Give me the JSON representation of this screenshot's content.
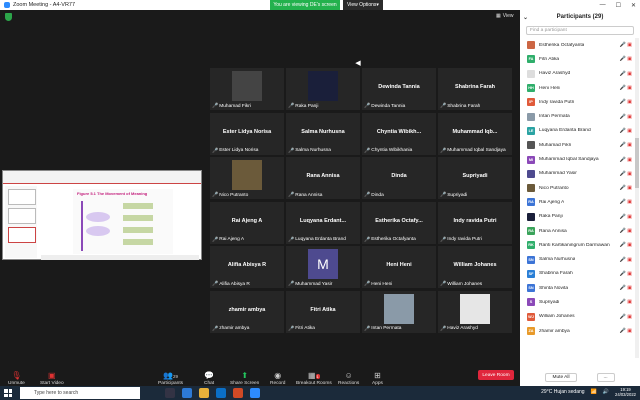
{
  "titlebar": {
    "title": "Zoom Meeting - A4-VR77",
    "viewing": "You are viewing DE's screen",
    "view_options": "View Options"
  },
  "meeting": {
    "view_label": "View",
    "pager": "◀"
  },
  "share": {
    "slide_title": "Figure 5.1 The Movement of Meaning"
  },
  "tiles": [
    {
      "name": "",
      "label": "Muhamad Fikri",
      "video": "photo",
      "color": "#444"
    },
    {
      "name": "",
      "label": "Raka Panji",
      "video": "photo",
      "color": "#1a1f3a"
    },
    {
      "name": "Dewinda Tannia",
      "label": "Dewinda Tannia"
    },
    {
      "name": "Shabrina Farah",
      "label": "Shabrina Farah"
    },
    {
      "name": "Ester Lidya Norisa",
      "label": "Ester Lidya Norisa"
    },
    {
      "name": "Salma Nurhusna",
      "label": "Salma Nurhusna"
    },
    {
      "name": "Chyntia  Wibikh...",
      "label": "Chyntia Wibikhania"
    },
    {
      "name": "Muhammad  Iqb...",
      "label": "Muhammad Iqbal Sandjaya"
    },
    {
      "name": "",
      "label": "Nico Putranto",
      "video": "photo",
      "color": "#6b5a3a"
    },
    {
      "name": "Rana Annisa",
      "label": "Rana Annisa"
    },
    {
      "name": "Dinda",
      "label": "Dinda"
    },
    {
      "name": "Supriyadi",
      "label": "Supriyadi"
    },
    {
      "name": "Rai Ajeng A",
      "label": "Rai Ajeng A"
    },
    {
      "name": "Luqyana  Erdant...",
      "label": "Luqyana Erdanta Brand"
    },
    {
      "name": "Estherika  Octafy...",
      "label": "Estherika Octafyanta"
    },
    {
      "name": "Indy ravida Putri",
      "label": "Indy ravida Putri"
    },
    {
      "name": "Alifia Abisya R",
      "label": "Alifia Abisya R"
    },
    {
      "name": "",
      "label": "Muhammad Yasir",
      "video": "letter",
      "letter": "M",
      "color": "#4e4a8f"
    },
    {
      "name": "Heni Heni",
      "label": "Heni Heni"
    },
    {
      "name": "William Johanes",
      "label": "William Johanes"
    },
    {
      "name": "zhamir ambya",
      "label": "zhamir ambya"
    },
    {
      "name": "Fitri Atika",
      "label": "Fitri Atika"
    },
    {
      "name": "",
      "label": "Intan Permata",
      "video": "photo",
      "color": "#8a9aa8"
    },
    {
      "name": "",
      "label": "Haviz Arashyd",
      "video": "blank",
      "color": "#e6e6e6"
    }
  ],
  "toolbar": {
    "unmute": "Unmute",
    "start_video": "Start Video",
    "participants": "Participants",
    "participants_count": "29",
    "chat": "Chat",
    "share_screen": "Share Screen",
    "record": "Record",
    "breakout": "Breakout Rooms",
    "reactions": "Reactions",
    "apps": "Apps",
    "leave": "Leave Room",
    "breakout_badge": "1"
  },
  "panel": {
    "title": "Participants (29)",
    "search_placeholder": "Find a participant",
    "mute_all": "Mute All",
    "more": "...",
    "participants": [
      {
        "initials": "",
        "name": "Estherika Octafyanta",
        "color": "#c64"
      },
      {
        "initials": "FA",
        "name": "Fitri Atika",
        "color": "#2fae6b"
      },
      {
        "initials": "",
        "name": "Haviz Arashyd",
        "color": "#ddd"
      },
      {
        "initials": "HH",
        "name": "Heni Heni",
        "color": "#2fae6b"
      },
      {
        "initials": "IP",
        "name": "Indy ravida Putri",
        "color": "#e05a3a"
      },
      {
        "initials": "",
        "name": "Intan Permata",
        "color": "#8a9aa8"
      },
      {
        "initials": "LE",
        "name": "Luqyana Erdanta Brand",
        "color": "#2aa3a3"
      },
      {
        "initials": "",
        "name": "Muhamad Fikri",
        "color": "#555"
      },
      {
        "initials": "MI",
        "name": "Muhammad Iqbal Sandjaya",
        "color": "#8b49b8"
      },
      {
        "initials": "",
        "name": "Muhammad Yasir",
        "color": "#4e4a8f"
      },
      {
        "initials": "",
        "name": "Nico Putranto",
        "color": "#6b5a3a"
      },
      {
        "initials": "RA",
        "name": "Rai Ajeng A",
        "color": "#3c74d6"
      },
      {
        "initials": "",
        "name": "Raka Panji",
        "color": "#1a1f3a"
      },
      {
        "initials": "RA",
        "name": "Rana Annisa",
        "color": "#3aa35a"
      },
      {
        "initials": "RK",
        "name": "Ranti Kartikaningrum Darmawan",
        "color": "#2fae6b"
      },
      {
        "initials": "SN",
        "name": "Salma Nurhusna",
        "color": "#3c74d6"
      },
      {
        "initials": "SF",
        "name": "Shabrina Farah",
        "color": "#2a7fd6"
      },
      {
        "initials": "SN",
        "name": "Shinta Novita",
        "color": "#3c74d6"
      },
      {
        "initials": "S",
        "name": "Supriyadi",
        "color": "#8b49b8"
      },
      {
        "initials": "WJ",
        "name": "William Johanes",
        "color": "#e05a3a"
      },
      {
        "initials": "ZA",
        "name": "zhamir ambya",
        "color": "#e89a2a"
      }
    ]
  },
  "taskbar": {
    "search_placeholder": "Type here to search",
    "weather": "29°C  Hujan sedang",
    "time": "19:19",
    "date": "24/03/2022"
  }
}
